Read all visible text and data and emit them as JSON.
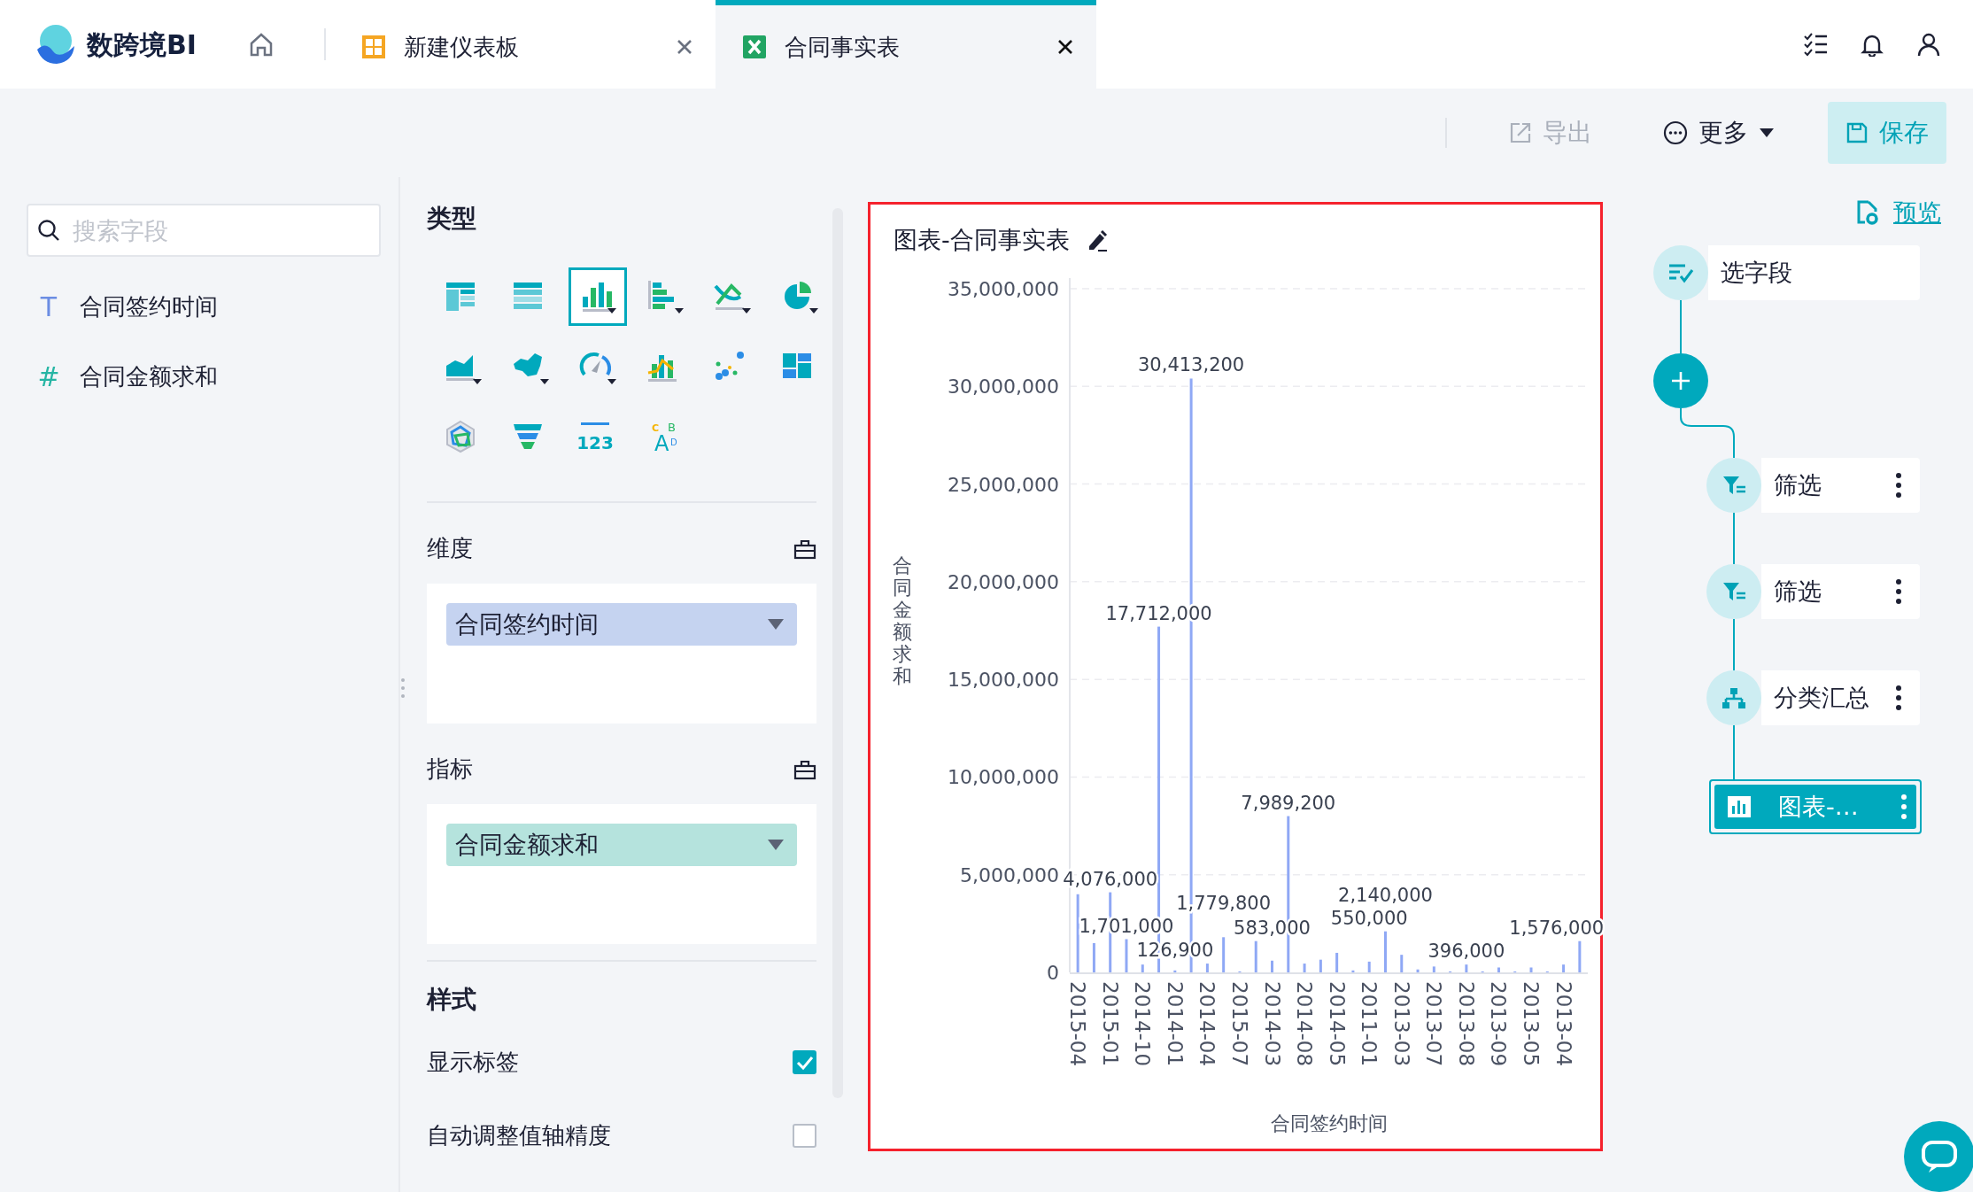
{
  "app": {
    "name": "数跨境BI"
  },
  "tabs": [
    {
      "label": "新建仪表板",
      "kind": "dashboard",
      "selected": false
    },
    {
      "label": "合同事实表",
      "kind": "sheet",
      "selected": true
    }
  ],
  "toolbar": [
    {
      "label": "导出",
      "kind": "export",
      "disabled": true
    },
    {
      "label": "更多",
      "kind": "more",
      "disabled": false
    },
    {
      "label": "保存",
      "kind": "save",
      "disabled": false
    }
  ],
  "fields": {
    "search": {
      "placeholder": "搜索字段"
    },
    "items": [
      {
        "mark": "T",
        "name": "合同签约时间",
        "kind": "dimension"
      },
      {
        "mark": "#",
        "name": "合同金额求和",
        "kind": "measure"
      }
    ]
  },
  "config": {
    "type_title": "类型",
    "chart_types": [
      {
        "kind": "cross-table",
        "selected": false
      },
      {
        "kind": "detail-table",
        "selected": false
      },
      {
        "kind": "column",
        "selected": true
      },
      {
        "kind": "bar",
        "selected": false
      },
      {
        "kind": "line",
        "selected": false
      },
      {
        "kind": "pie",
        "selected": false
      },
      {
        "kind": "area",
        "selected": false
      },
      {
        "kind": "map",
        "selected": false
      },
      {
        "kind": "gauge",
        "selected": false
      },
      {
        "kind": "combo",
        "selected": false
      },
      {
        "kind": "scatter",
        "selected": false
      },
      {
        "kind": "treemap",
        "selected": false
      },
      {
        "kind": "radar",
        "selected": false
      },
      {
        "kind": "funnel",
        "selected": false
      },
      {
        "kind": "kpi",
        "selected": false,
        "glyphs": [
          "123"
        ]
      },
      {
        "kind": "wordcloud",
        "selected": false,
        "glyphs": [
          "C",
          "A",
          "B",
          "D"
        ]
      }
    ],
    "sections": [
      {
        "title": "维度",
        "kind": "dimension",
        "pills": [
          {
            "label": "合同签约时间"
          }
        ]
      },
      {
        "title": "指标",
        "kind": "measure",
        "pills": [
          {
            "label": "合同金额求和"
          }
        ]
      }
    ],
    "style": {
      "title": "样式",
      "options": [
        {
          "label": "显示标签",
          "checked": true
        },
        {
          "label": "自动调整值轴精度",
          "checked": false
        }
      ]
    }
  },
  "chart": {
    "title": "图表-合同事实表",
    "chart_data": {
      "type": "bar",
      "xlabel": "合同签约时间",
      "ylabel": "合同金额求和",
      "categories": [
        "2015-04",
        null,
        "2015-01",
        null,
        "2014-10",
        null,
        "2014-01",
        null,
        "2014-04",
        null,
        "2015-07",
        null,
        "2014-03",
        null,
        "2014-08",
        null,
        "2014-05",
        null,
        "2011-01",
        null,
        "2013-03",
        null,
        "2013-07",
        null,
        "2013-08",
        null,
        "2013-09",
        null,
        "2013-05",
        null,
        "2013-04",
        null
      ],
      "ylim": [
        0,
        35000000
      ],
      "grid": true,
      "yticks": [
        {
          "value": 0,
          "label": "0"
        },
        {
          "value": 5000000,
          "label": "5,000,000"
        },
        {
          "value": 10000000,
          "label": "10,000,000"
        },
        {
          "value": 15000000,
          "label": "15,000,000"
        },
        {
          "value": 20000000,
          "label": "20,000,000"
        },
        {
          "value": 25000000,
          "label": "25,000,000"
        },
        {
          "value": 30000000,
          "label": "30,000,000"
        },
        {
          "value": 35000000,
          "label": "35,000,000"
        }
      ],
      "series": [
        {
          "color": "#8fa8f5",
          "values": [
            4000000,
            1500000,
            4100000,
            1700000,
            400000,
            17700000,
            100000,
            30400000,
            450000,
            1800000,
            50000,
            1600000,
            600000,
            8000000,
            450000,
            650000,
            1000000,
            100000,
            550000,
            2100000,
            900000,
            150000,
            300000,
            50000,
            400000,
            50000,
            250000,
            50000,
            250000,
            50000,
            400000,
            1600000
          ]
        }
      ],
      "value_labels": [
        null,
        null,
        "4,076,000",
        "1,701,000",
        null,
        "17,712,000",
        "126,900",
        "30,413,200",
        null,
        "1,779,800",
        null,
        null,
        "583,000",
        "7,989,200",
        null,
        null,
        null,
        null,
        "550,000",
        "2,140,000",
        null,
        null,
        null,
        null,
        "396,000",
        null,
        null,
        null,
        null,
        null,
        null,
        "1,576,000"
      ]
    }
  },
  "flow": {
    "preview": "预览",
    "nodes": [
      {
        "kind": "select",
        "label": "选字段",
        "selected": false
      },
      {
        "kind": "add",
        "selected": false
      },
      {
        "kind": "filter",
        "label": "筛选",
        "selected": false
      },
      {
        "kind": "filter",
        "label": "筛选",
        "selected": false
      },
      {
        "kind": "summary",
        "label": "分类汇总",
        "selected": false
      },
      {
        "kind": "chart",
        "label": "图表-…",
        "selected": true
      }
    ]
  }
}
